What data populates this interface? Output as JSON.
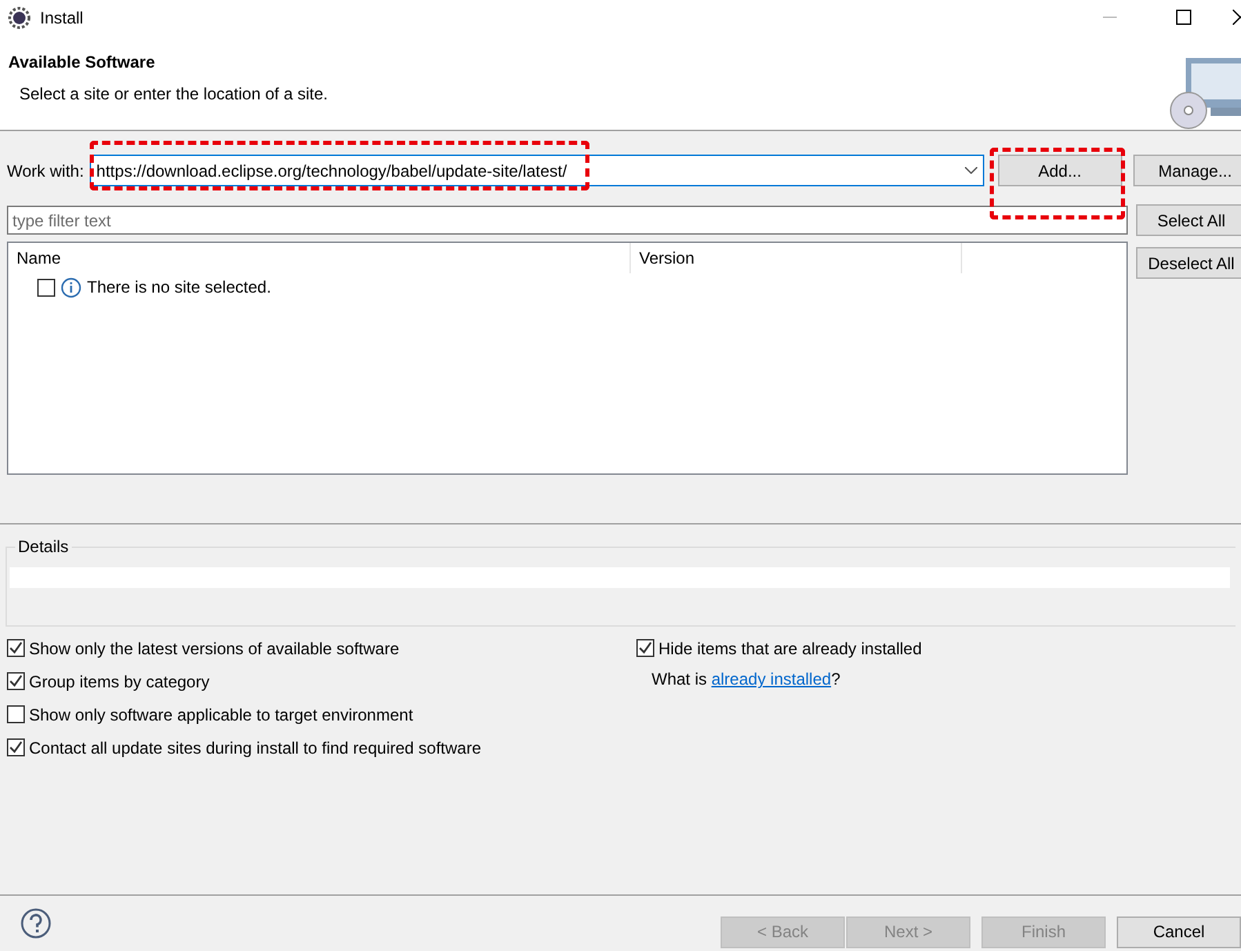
{
  "window": {
    "title": "Install"
  },
  "header": {
    "title": "Available Software",
    "subtitle": "Select a site or enter the location of a site."
  },
  "work_with": {
    "label": "Work with:",
    "value": "https://download.eclipse.org/technology/babel/update-site/latest/",
    "highlighted": true
  },
  "site_buttons": [
    {
      "label": "Add...",
      "highlighted": true
    },
    {
      "label": "Manage...",
      "highlighted": false
    }
  ],
  "filter": {
    "placeholder": "type filter text"
  },
  "selection_buttons": [
    "Select All",
    "Deselect All"
  ],
  "table": {
    "columns": [
      "Name",
      "Version"
    ],
    "rows": [
      {
        "checked": false,
        "text": "There is no site selected."
      }
    ]
  },
  "details": {
    "label": "Details"
  },
  "options_left": [
    {
      "label": "Show only the latest versions of available software",
      "checked": true
    },
    {
      "label": "Group items by category",
      "checked": true
    },
    {
      "label": "Show only software applicable to target environment",
      "checked": false
    },
    {
      "label": "Contact all update sites during install to find required software",
      "checked": true
    }
  ],
  "options_right": [
    {
      "label": "Hide items that are already installed",
      "checked": true
    }
  ],
  "installed_hint": {
    "before": "What is ",
    "link": "already installed",
    "after": "?"
  },
  "buttons": [
    {
      "label": "< Back",
      "disabled": true
    },
    {
      "label": "Next >",
      "disabled": true
    },
    {
      "label": "Finish",
      "disabled": true
    },
    {
      "label": "Cancel",
      "disabled": false
    }
  ]
}
